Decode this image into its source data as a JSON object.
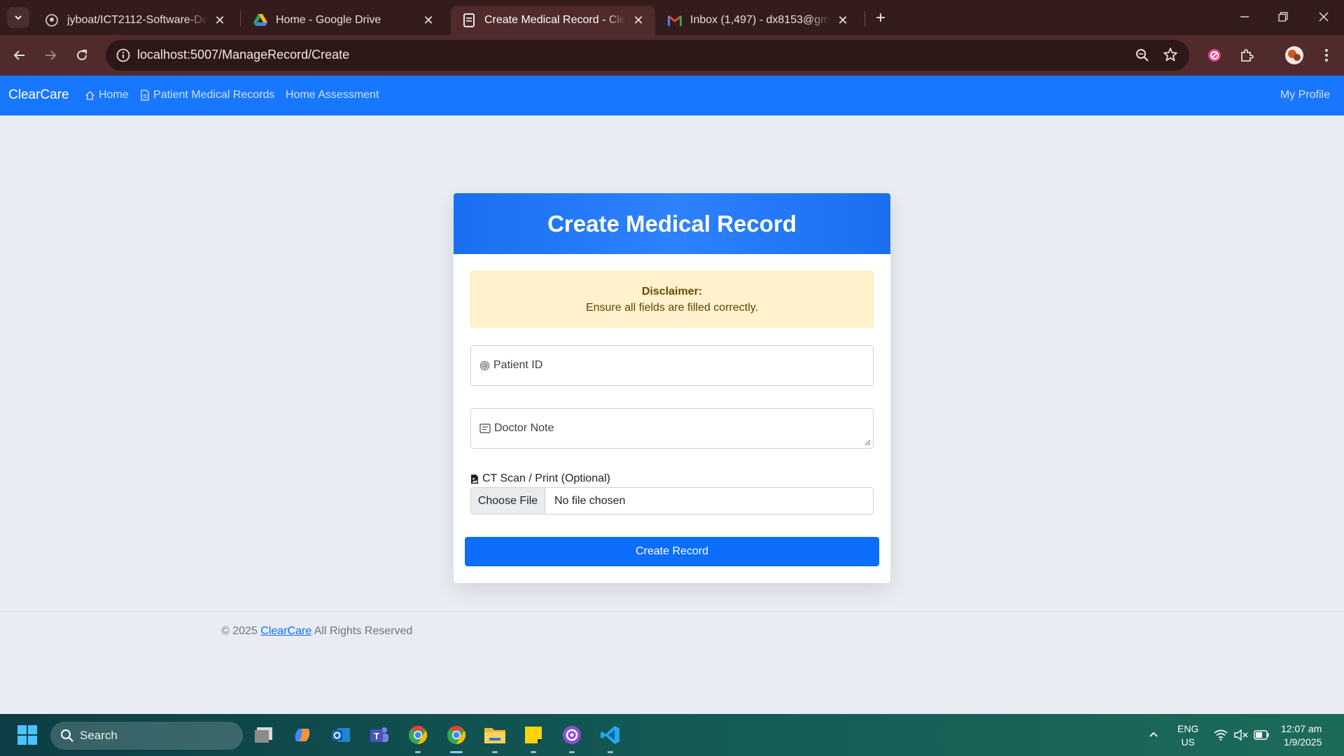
{
  "browser": {
    "tabs": [
      {
        "title": "jyboat/ICT2112-Software-Design",
        "icon": "github-icon",
        "active": false
      },
      {
        "title": "Home - Google Drive",
        "icon": "google-drive-icon",
        "active": false
      },
      {
        "title": "Create Medical Record - ClearCare",
        "icon": "document-icon",
        "active": true
      },
      {
        "title": "Inbox (1,497) - dx8153@gmail.com",
        "icon": "gmail-icon",
        "active": false
      }
    ],
    "url": "localhost:5007/ManageRecord/Create",
    "tab_bar_color": "#351c1c",
    "toolbar_color": "#4f2b2b"
  },
  "nav": {
    "brand": "ClearCare",
    "links": [
      {
        "label": "Home",
        "icon": "home-icon"
      },
      {
        "label": "Patient Medical Records",
        "icon": "file-text-icon"
      },
      {
        "label": "Home Assessment",
        "icon": ""
      }
    ],
    "profile": "My Profile",
    "color": "#1877ff"
  },
  "form": {
    "title": "Create Medical Record",
    "disclaimer": {
      "title": "Disclaimer:",
      "text": "Ensure all fields are filled correctly."
    },
    "patient_id_placeholder": "Patient ID",
    "doctor_note_placeholder": "Doctor Note",
    "file_label": "CT Scan / Print (Optional)",
    "file_button": "Choose File",
    "file_status": "No file chosen",
    "submit": "Create Record",
    "accent": "#0d6efd"
  },
  "footer": {
    "prefix": "© 2025",
    "link": "ClearCare",
    "suffix": "All Rights Reserved"
  },
  "taskbar": {
    "search_placeholder": "Search",
    "lang_line1": "ENG",
    "lang_line2": "US",
    "time": "12:07 am",
    "date": "1/9/2025"
  }
}
